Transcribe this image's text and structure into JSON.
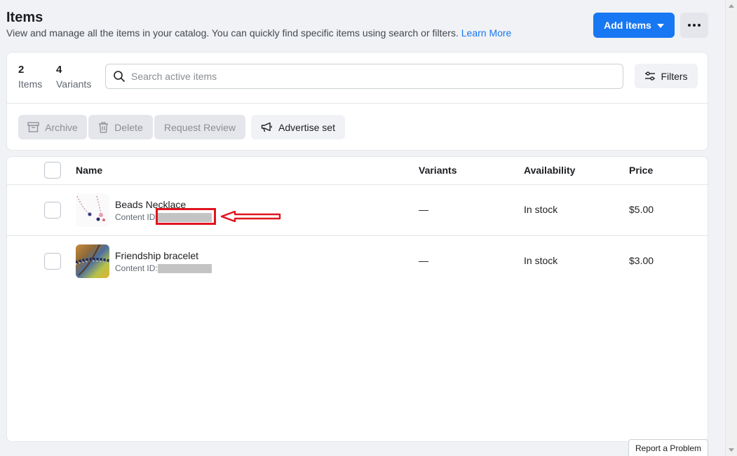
{
  "header": {
    "title": "Items",
    "description": "View and manage all the items in your catalog. You can quickly find specific items using search or filters.",
    "learn_more": "Learn More",
    "add_items_label": "Add items",
    "more_icon": "more-horizontal-icon"
  },
  "summary": {
    "items_count": "2",
    "items_label": "Items",
    "variants_count": "4",
    "variants_label": "Variants"
  },
  "search": {
    "placeholder": "Search active items",
    "value": ""
  },
  "filters_label": "Filters",
  "toolbar": {
    "archive_label": "Archive",
    "delete_label": "Delete",
    "request_review_label": "Request Review",
    "advertise_label": "Advertise set"
  },
  "table": {
    "columns": [
      "Name",
      "Variants",
      "Availability",
      "Price"
    ],
    "rows": [
      {
        "name": "Beads Necklace",
        "content_id_label": "Content ID:",
        "variants": "—",
        "availability": "In stock",
        "price": "$5.00"
      },
      {
        "name": "Friendship bracelet",
        "content_id_label": "Content ID:",
        "variants": "—",
        "availability": "In stock",
        "price": "$3.00"
      }
    ]
  },
  "report_label": "Report a Problem",
  "colors": {
    "primary": "#1877f2",
    "annotation_red": "#e0141e"
  }
}
